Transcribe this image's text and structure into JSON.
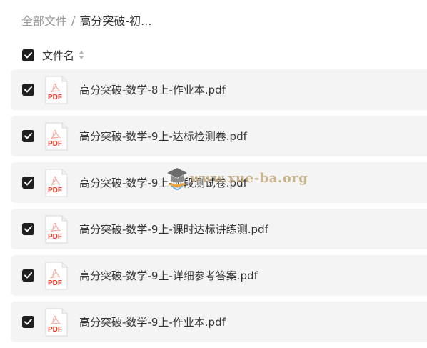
{
  "breadcrumb": {
    "root": "全部文件",
    "separator": "/",
    "current": "高分突破-初..."
  },
  "header": {
    "column_label": "文件名",
    "select_all_checked": true
  },
  "file_icon_label": "PDF",
  "files": [
    {
      "name": "高分突破-数学-8上-作业本.pdf",
      "checked": true
    },
    {
      "name": "高分突破-数学-9上-达标检测卷.pdf",
      "checked": true
    },
    {
      "name": "高分突破-数学-9上-阶段测试卷.pdf",
      "checked": true
    },
    {
      "name": "高分突破-数学-9上-课时达标讲练测.pdf",
      "checked": true
    },
    {
      "name": "高分突破-数学-9上-详细参考答案.pdf",
      "checked": true
    },
    {
      "name": "高分突破-数学-9上-作业本.pdf",
      "checked": true
    }
  ],
  "watermark": {
    "text": "www.xue-ba.org"
  },
  "colors": {
    "pdf_red": "#e2402f",
    "row_bg": "#f4f4f4",
    "checkbox": "#1f1f1f"
  }
}
